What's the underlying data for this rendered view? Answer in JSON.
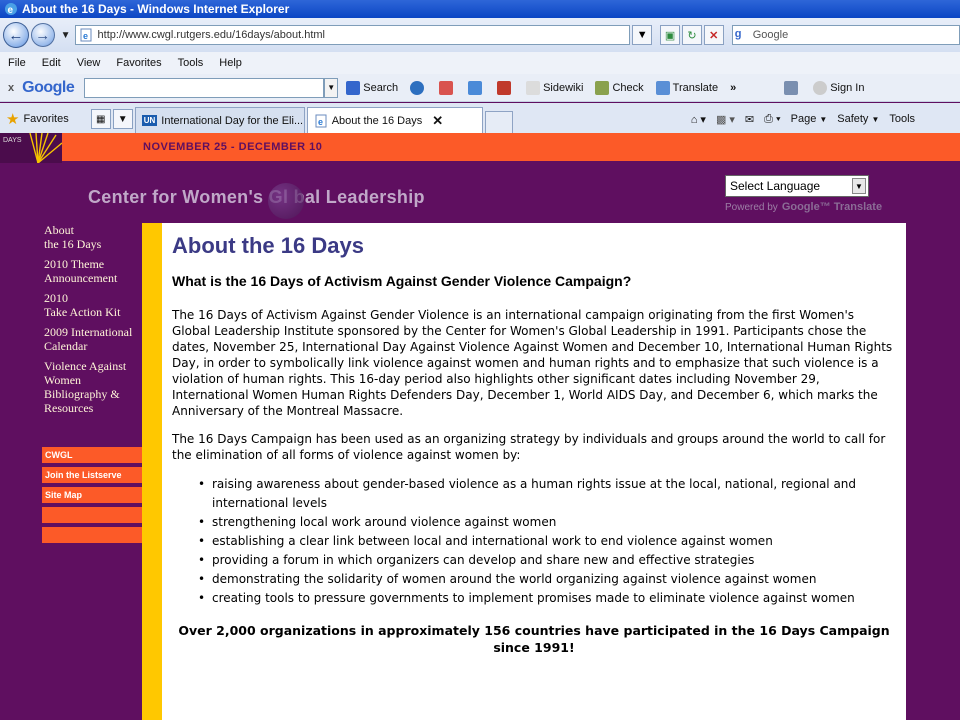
{
  "window": {
    "title": "About the 16 Days - Windows Internet Explorer"
  },
  "address_bar": {
    "url": "http://www.cwgl.rutgers.edu/16days/about.html",
    "search_placeholder": "Google"
  },
  "menu": {
    "items": [
      "File",
      "Edit",
      "View",
      "Favorites",
      "Tools",
      "Help"
    ]
  },
  "google_toolbar": {
    "logo": "Google",
    "search_label": "Search",
    "sidewiki_label": "Sidewiki",
    "check_label": "Check",
    "translate_label": "Translate",
    "more_label": "»",
    "signin_label": "Sign In"
  },
  "tabs_bar": {
    "favorites_label": "Favorites",
    "tabs": [
      {
        "label": "International Day for the Eli...",
        "icon": "un-icon"
      },
      {
        "label": "About the 16 Days",
        "icon": "ie-page-icon"
      }
    ],
    "page_label": "Page",
    "safety_label": "Safety",
    "tools_label": "Tools"
  },
  "site": {
    "date_banner": "NOVEMBER 25 - DECEMBER 10",
    "org_title": "Center for Women's Gl bal Leadership",
    "language_select": "Select Language",
    "powered_by": "Powered by",
    "translate_brand": "Google™ Translate",
    "logo_text": "DAYS",
    "nav": [
      {
        "line1": "About",
        "line2": "the 16 Days"
      },
      {
        "line1": "2010 Theme",
        "line2": "Announcement"
      },
      {
        "line1": "2010",
        "line2": "Take Action Kit"
      },
      {
        "line1": "2009 International",
        "line2": "Calendar"
      },
      {
        "line1": "Violence Against",
        "line2": "Women",
        "line3": "Bibliography &",
        "line4": "Resources"
      }
    ],
    "side_buttons": [
      "CWGL",
      "Join the Listserve",
      "Site Map",
      "",
      ""
    ]
  },
  "content": {
    "heading": "About the 16 Days",
    "subheading": "What is the 16 Days of Activism Against Gender Violence Campaign?",
    "para1": "The 16 Days of Activism Against Gender Violence is an international campaign originating from the first Women's Global Leadership Institute sponsored by the Center for Women's Global Leadership in 1991. Participants chose the dates, November 25, International Day Against Violence Against Women and December 10, International Human Rights Day, in order to symbolically link violence against women and human rights and to emphasize that such violence is a violation of human rights. This 16-day period also highlights other significant dates including November 29, International Women Human Rights Defenders Day, December 1, World AIDS Day, and December 6, which marks the Anniversary of the Montreal Massacre.",
    "para2": "The 16 Days Campaign has been used as an organizing strategy by individuals and groups around the world to call for the elimination of all forms of violence against women by:",
    "bullets": [
      "raising awareness about gender-based violence as a human rights issue at the local, national, regional and international levels",
      "strengthening local work around violence against women",
      "establishing a clear link between local and international work to end violence against women",
      "providing a forum in which organizers can develop and share new and effective strategies",
      "demonstrating the solidarity of women around the world organizing against violence against women",
      "creating tools to pressure governments to implement promises made to eliminate violence against women"
    ],
    "closing": "Over 2,000 organizations in approximately 156 countries have participated in the 16 Days Campaign since 1991!"
  },
  "colors": {
    "purple": "#5f0f60",
    "orange": "#fc5a28",
    "yellow": "#ffc800",
    "heading_blue": "#3b3a85"
  }
}
